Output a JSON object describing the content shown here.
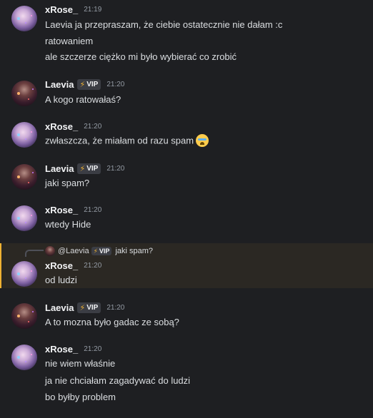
{
  "messages": [
    {
      "author": "xRose_",
      "time": "21:19",
      "lines": [
        "Laevia ja przepraszam, że ciebie ostatecznie nie dałam :c",
        "ratowaniem",
        "ale szczerze ciężko mi było wybierać co zrobić"
      ]
    },
    {
      "author": "Laevia",
      "badge": "VIP",
      "time": "21:20",
      "lines": [
        "A kogo ratowałaś?"
      ]
    },
    {
      "author": "xRose_",
      "time": "21:20",
      "lines": [
        "zwłaszcza, że miałam od razu spam"
      ],
      "emoji": "crying-face-emoji"
    },
    {
      "author": "Laevia",
      "badge": "VIP",
      "time": "21:20",
      "lines": [
        "jaki spam?"
      ]
    },
    {
      "author": "xRose_",
      "time": "21:20",
      "lines": [
        "wtedy Hide"
      ]
    },
    {
      "reply": {
        "name": "@Laevia",
        "badge": "VIP",
        "text": "jaki spam?"
      },
      "author": "xRose_",
      "time": "21:20",
      "lines": [
        "od ludzi"
      ]
    },
    {
      "author": "Laevia",
      "badge": "VIP",
      "time": "21:20",
      "lines": [
        "A to mozna było gadac ze sobą?"
      ]
    },
    {
      "author": "xRose_",
      "time": "21:20",
      "lines": [
        "nie wiem właśnie",
        "ja nie chciałam zagadywać do ludzi",
        "bo byłby problem"
      ]
    }
  ],
  "colors": {
    "background": "#1e1f22",
    "reply_highlight": "#2b2823",
    "vip_bolt": "#f0b232"
  }
}
